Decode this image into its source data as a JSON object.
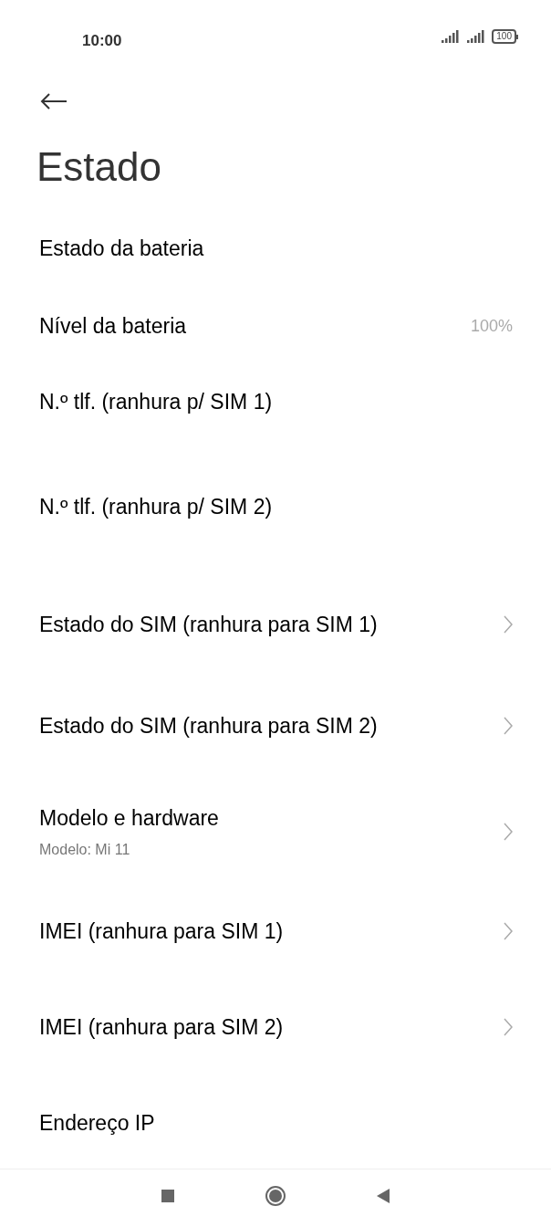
{
  "status_bar": {
    "time": "10:00",
    "battery": "100"
  },
  "title": "Estado",
  "items": [
    {
      "label": "Estado da bateria",
      "chevron": false
    },
    {
      "label": "Nível da bateria",
      "value": "100%",
      "chevron": false
    },
    {
      "label": "N.º tlf. (ranhura p/ SIM 1)",
      "chevron": false
    },
    {
      "label": "N.º tlf. (ranhura p/ SIM 2)",
      "chevron": false
    },
    {
      "label": "Estado do SIM (ranhura para SIM 1)",
      "chevron": true
    },
    {
      "label": "Estado do SIM (ranhura para SIM 2)",
      "chevron": true
    },
    {
      "label": "Modelo e hardware",
      "sublabel": "Modelo: Mi 11",
      "chevron": true
    },
    {
      "label": "IMEI (ranhura para SIM 1)",
      "chevron": true
    },
    {
      "label": "IMEI (ranhura para SIM 2)",
      "chevron": true
    },
    {
      "label": "Endereço IP",
      "chevron": false
    }
  ]
}
